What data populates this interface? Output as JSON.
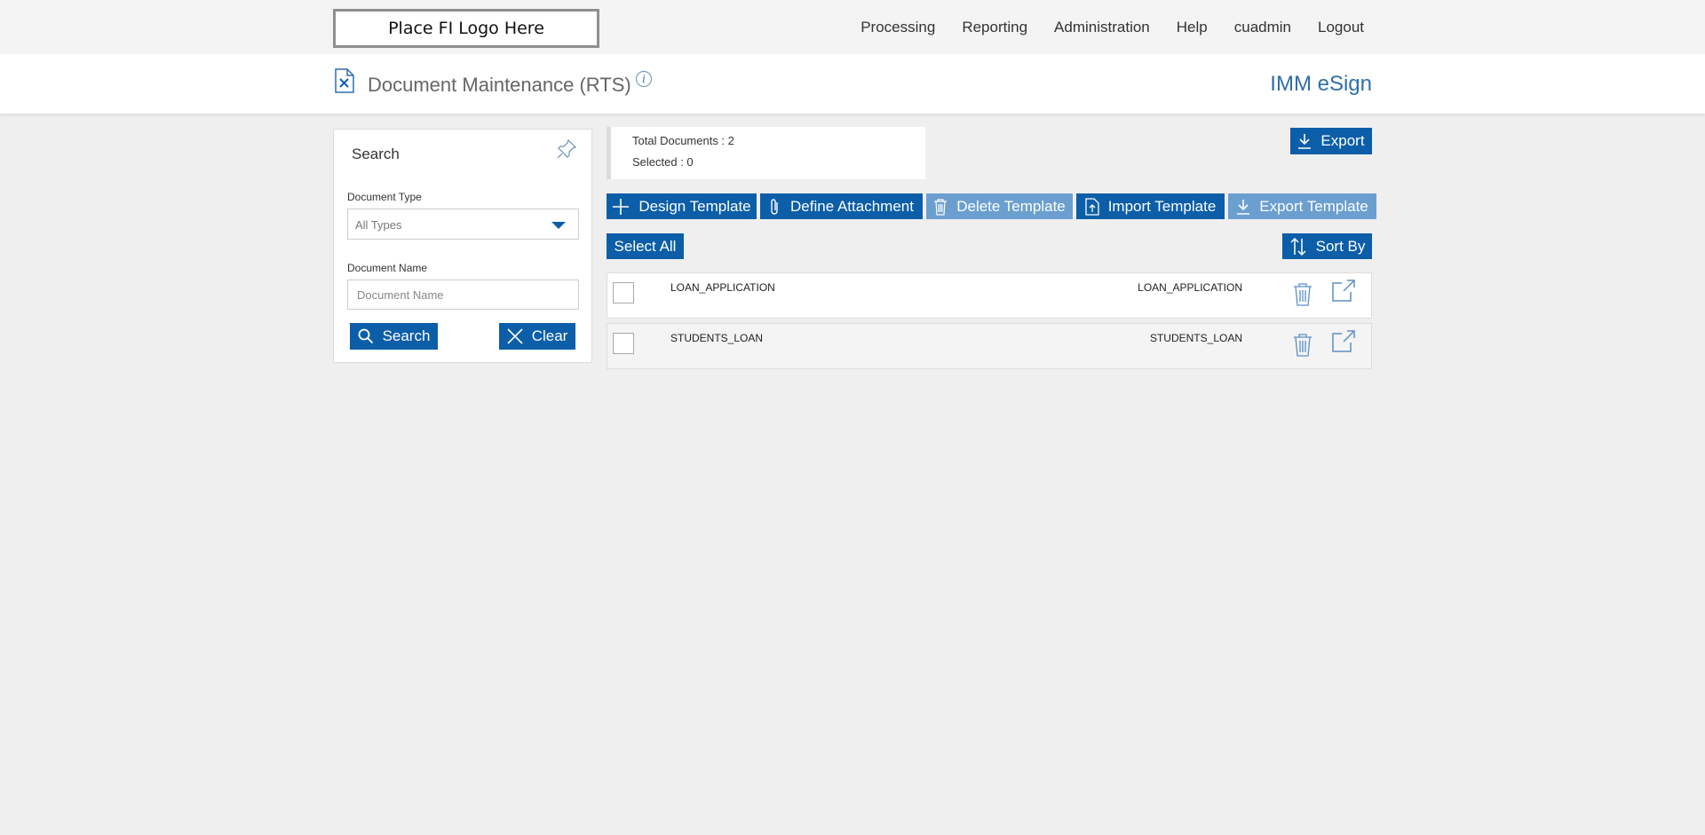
{
  "header": {
    "logo_text": "Place FI Logo Here",
    "nav": [
      "Processing",
      "Reporting",
      "Administration",
      "Help",
      "cuadmin",
      "Logout"
    ]
  },
  "titlebar": {
    "title": "Document Maintenance (RTS)",
    "info": "i",
    "brand": "IMM eSign"
  },
  "search": {
    "title": "Search",
    "doc_type_label": "Document Type",
    "doc_type_value": "All Types",
    "doc_name_label": "Document Name",
    "doc_name_placeholder": "Document Name",
    "search_button": "Search",
    "clear_button": "Clear"
  },
  "summary": {
    "total": "Total Documents : 2",
    "selected": "Selected : 0"
  },
  "toolbar": {
    "export": "Export",
    "design_template": "Design Template",
    "define_attachment": "Define Attachment",
    "delete_template": "Delete Template",
    "import_template": "Import Template",
    "export_template": "Export Template",
    "select_all": "Select All",
    "sort_by": "Sort By"
  },
  "documents": [
    {
      "name": "LOAN_APPLICATION",
      "name2": "LOAN_APPLICATION"
    },
    {
      "name": "STUDENTS_LOAN",
      "name2": "STUDENTS_LOAN"
    }
  ],
  "colors": {
    "primary": "#0c5ea8",
    "disabled": "#6b9fcf",
    "brand_text": "#2f6ea8"
  }
}
